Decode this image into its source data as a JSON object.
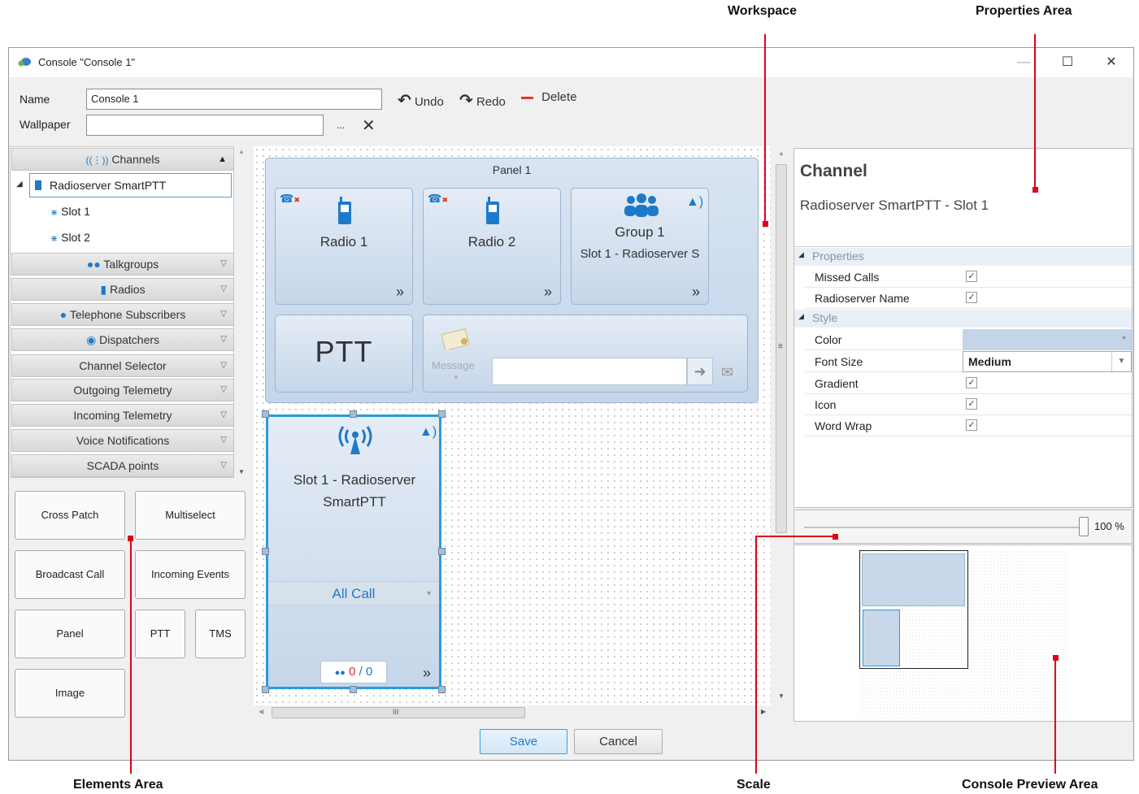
{
  "callouts": {
    "workspace": "Workspace",
    "properties_area": "Properties Area",
    "elements_area": "Elements Area",
    "scale": "Scale",
    "console_preview_area": "Console Preview Area"
  },
  "window": {
    "title": "Console \"Console 1\"",
    "minimize": "—",
    "maximize": "☐",
    "close": "✕"
  },
  "form": {
    "name_label": "Name",
    "name_value": "Console 1",
    "wallpaper_label": "Wallpaper",
    "wallpaper_value": "",
    "browse": "...",
    "clear": "✕"
  },
  "toolbar": {
    "undo": "Undo",
    "redo": "Redo",
    "delete": "Delete"
  },
  "elements": {
    "channels_header": "Channels",
    "tree_root": "Radioserver SmartPTT",
    "tree_children": [
      "Slot 1",
      "Slot 2"
    ],
    "sections": [
      "Talkgroups",
      "Radios",
      "Telephone Subscribers",
      "Dispatchers",
      "Channel Selector",
      "Outgoing Telemetry",
      "Incoming Telemetry",
      "Voice Notifications",
      "SCADA points"
    ],
    "buttons": [
      "Cross Patch",
      "Multiselect",
      "Broadcast Call",
      "Incoming Events",
      "Panel",
      "PTT",
      "TMS",
      "Image"
    ]
  },
  "workspace": {
    "panel_title": "Panel 1",
    "tiles": {
      "radio1": "Radio 1",
      "radio2": "Radio 2",
      "group1": "Group 1",
      "group1_sub": "Slot 1 - Radioserver S",
      "ptt": "PTT",
      "message": "Message",
      "more": "»"
    },
    "channel_tile": {
      "name": "Slot 1 - Radioserver SmartPTT",
      "call_select": "All Call",
      "counter_a": "0",
      "counter_sep": "/",
      "counter_b": "0"
    },
    "hscroll_grip": "III",
    "vscroll_grip": "≡"
  },
  "properties": {
    "type_title": "Channel",
    "object_name": "Radioserver SmartPTT - Slot 1",
    "categories": [
      "Properties",
      "Style"
    ],
    "rows": [
      {
        "name": "Missed Calls",
        "checked": true
      },
      {
        "name": "Radioserver Name",
        "checked": true
      },
      {
        "name": "Color",
        "value": ""
      },
      {
        "name": "Font Size",
        "value": "Medium"
      },
      {
        "name": "Gradient",
        "checked": true
      },
      {
        "name": "Icon",
        "checked": true
      },
      {
        "name": "Word Wrap",
        "checked": true
      }
    ],
    "check_glyph": "✓"
  },
  "scale": {
    "value": "100 %",
    "fraction": 1.0
  },
  "footer": {
    "save": "Save",
    "cancel": "Cancel"
  },
  "colors": {
    "accent": "#1e7ac9",
    "callout_red": "#e0001a",
    "selection": "#2b9be0"
  }
}
